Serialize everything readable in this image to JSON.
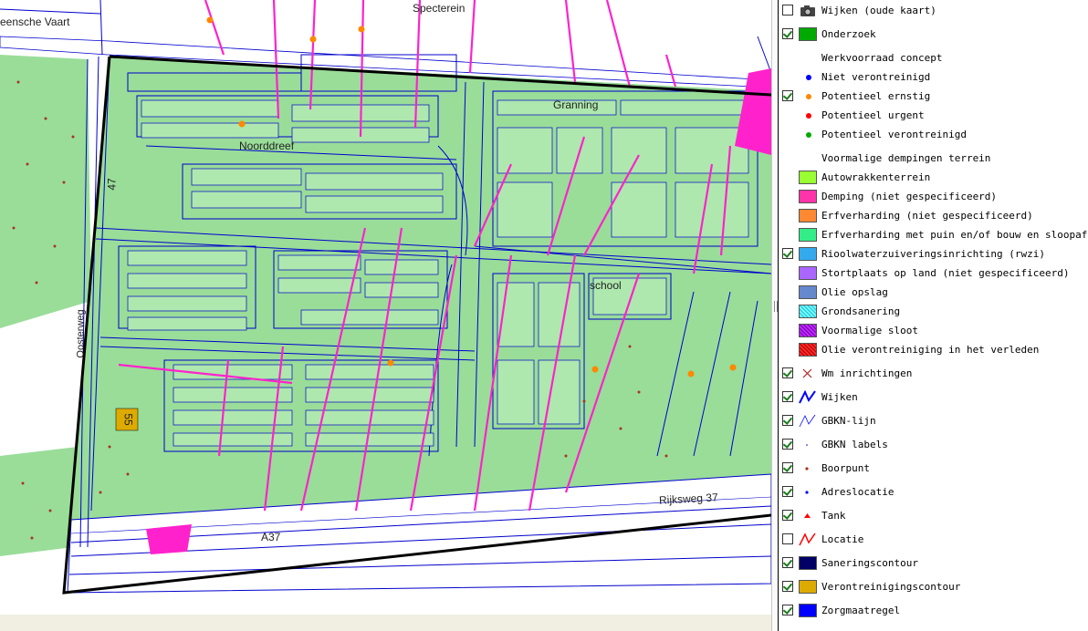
{
  "map": {
    "labels": {
      "vaart": "eensche Vaart",
      "straat_top": "Specterein",
      "noorddreef": "Noorddreef",
      "granning": "Granning",
      "school": "school",
      "rijksweg": "Rijksweg 37",
      "a37": "A37",
      "nummer_47": "47",
      "nummer_55": "55",
      "west_weg": "Oosterweg"
    },
    "colors": {
      "area_green": "#99dd99",
      "lot_green": "#aee8ae",
      "road_blue": "#0000cc",
      "outline_black": "#000000",
      "pink": "#ff22cc",
      "orange": "#ff8800",
      "gold": "#ddaa00"
    }
  },
  "legend": {
    "items": [
      {
        "label": "Wijken (oude kaart)",
        "checked": false,
        "symbol": "camera-icon"
      },
      {
        "label": "Onderzoek",
        "checked": true,
        "symbol": "swatch",
        "color": "#00aa00"
      },
      {
        "label": "Werkvoorraad concept",
        "type": "header"
      },
      {
        "label": "Niet verontreinigd",
        "type": "sub",
        "symbol": "dot",
        "color": "#0000ff"
      },
      {
        "label": "Potentieel ernstig",
        "checked": true,
        "type": "sub",
        "symbol": "dot",
        "color": "#ff8800"
      },
      {
        "label": "Potentieel urgent",
        "type": "sub",
        "symbol": "dot",
        "color": "#ff0000"
      },
      {
        "label": "Potentieel verontreinigd",
        "type": "sub",
        "symbol": "dot",
        "color": "#00aa00"
      },
      {
        "label": "Voormalige dempingen terrein",
        "type": "header"
      },
      {
        "label": "Autowrakkenterrein",
        "type": "sub",
        "symbol": "swatch",
        "color": "#99ff33"
      },
      {
        "label": "Demping (niet gespecificeerd)",
        "type": "sub",
        "symbol": "swatch",
        "color": "#ff33aa"
      },
      {
        "label": "Erfverharding (niet gespecificeerd)",
        "type": "sub",
        "symbol": "swatch",
        "color": "#ff8833"
      },
      {
        "label": "Erfverharding met puin en/of bouw en sloopafval",
        "type": "sub",
        "symbol": "swatch",
        "color": "#33ee88"
      },
      {
        "label": "Rioolwaterzuiveringsinrichting (rwzi)",
        "checked": true,
        "type": "sub",
        "symbol": "swatch",
        "color": "#33aaee"
      },
      {
        "label": "Stortplaats op land (niet gespecificeerd)",
        "type": "sub",
        "symbol": "swatch",
        "color": "#aa66ff"
      },
      {
        "label": "Olie opslag",
        "type": "sub",
        "symbol": "swatch",
        "color": "#6688cc"
      },
      {
        "label": "Grondsanering",
        "type": "sub",
        "symbol": "pattern-cyan"
      },
      {
        "label": "Voormalige sloot",
        "type": "sub",
        "symbol": "pattern-purple"
      },
      {
        "label": "Olie verontreiniging in het verleden",
        "type": "sub",
        "symbol": "pattern-red"
      },
      {
        "label": "Wm inrichtingen",
        "checked": true,
        "symbol": "cross-icon"
      },
      {
        "label": "Wijken",
        "checked": true,
        "symbol": "line-blue-thick"
      },
      {
        "label": "GBKN-lijn",
        "checked": true,
        "symbol": "line-blue-thin"
      },
      {
        "label": "GBKN labels",
        "checked": true,
        "symbol": "tiny-dot"
      },
      {
        "label": "Boorpunt",
        "checked": true,
        "symbol": "small-dot-brown"
      },
      {
        "label": "Adreslocatie",
        "checked": true,
        "symbol": "small-dot-blue"
      },
      {
        "label": "Tank",
        "checked": true,
        "symbol": "triangle-red"
      },
      {
        "label": "Locatie",
        "checked": false,
        "symbol": "line-red"
      },
      {
        "label": "Saneringscontour",
        "checked": true,
        "symbol": "swatch",
        "color": "#000066"
      },
      {
        "label": "Verontreinigingscontour",
        "checked": true,
        "symbol": "swatch",
        "color": "#ddaa00"
      },
      {
        "label": "Zorgmaatregel",
        "checked": true,
        "symbol": "swatch",
        "color": "#0000ff"
      }
    ]
  }
}
